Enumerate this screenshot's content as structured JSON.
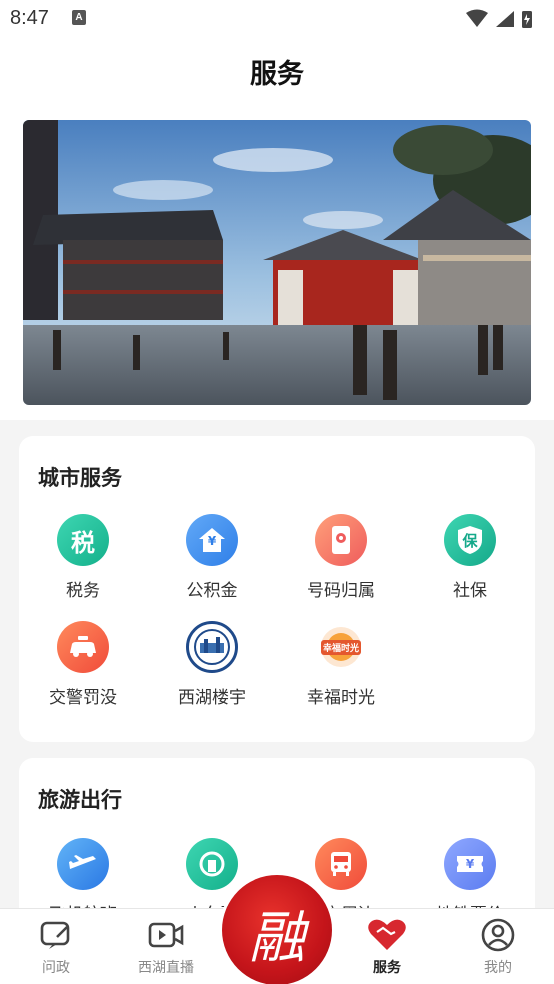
{
  "status": {
    "time": "8:47",
    "notif_letter": "A"
  },
  "header": {
    "title": "服务"
  },
  "city": {
    "title": "城市服务",
    "items": [
      {
        "label": "税务",
        "glyph": "税",
        "icon": "tax-icon"
      },
      {
        "label": "公积金",
        "glyph": "¥",
        "icon": "housing-fund-icon"
      },
      {
        "label": "号码归属",
        "glyph": "",
        "icon": "phone-location-icon"
      },
      {
        "label": "社保",
        "glyph": "保",
        "icon": "social-security-icon"
      },
      {
        "label": "交警罚没",
        "glyph": "",
        "icon": "traffic-police-icon"
      },
      {
        "label": "西湖楼宇",
        "glyph": "",
        "icon": "xihu-building-icon"
      },
      {
        "label": "幸福时光",
        "glyph": "幸福时光",
        "icon": "happy-time-icon"
      }
    ]
  },
  "travel": {
    "title": "旅游出行",
    "items": [
      {
        "label": "飞机航班",
        "icon": "airplane-icon"
      },
      {
        "label": "火车票",
        "icon": "train-icon"
      },
      {
        "label": "公交周边",
        "icon": "bus-icon"
      },
      {
        "label": "地铁票价",
        "glyph": "¥",
        "icon": "metro-ticket-icon"
      }
    ]
  },
  "tabbar": {
    "tabs": [
      {
        "label": "问政",
        "icon": "chat-edit-icon"
      },
      {
        "label": "西湖直播",
        "icon": "video-icon"
      },
      {
        "label": "服务",
        "icon": "heart-handshake-icon"
      },
      {
        "label": "我的",
        "icon": "user-icon"
      }
    ],
    "center_glyph": "融"
  },
  "colors": {
    "accent": "#d7282f",
    "tab_inactive": "#888888"
  }
}
